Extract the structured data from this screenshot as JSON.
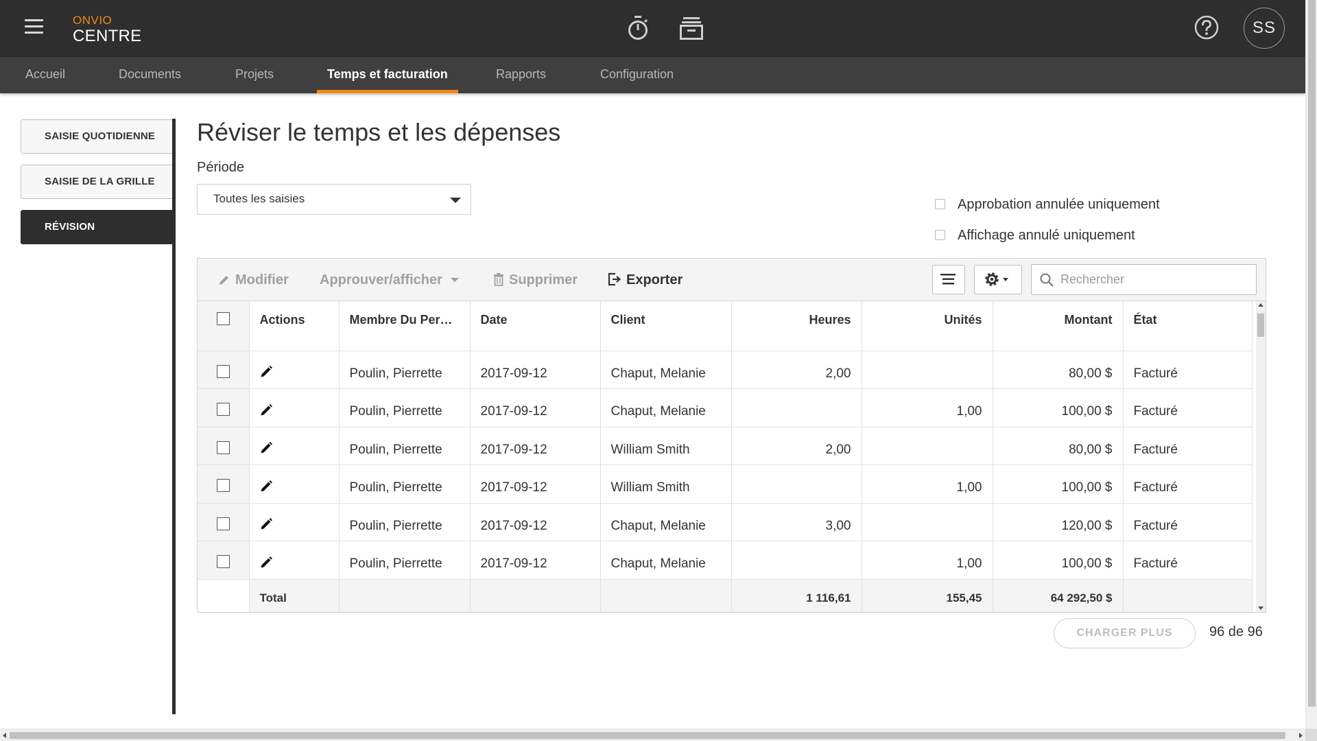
{
  "app": {
    "brand_top": "ONVIO",
    "brand_bottom": "CENTRE",
    "avatar_initials": "SS",
    "accent_color": "#f08a16",
    "header_icons": [
      "menu-icon",
      "timer-icon",
      "archive-icon",
      "help-icon"
    ]
  },
  "nav": {
    "tabs": [
      {
        "label": "Accueil"
      },
      {
        "label": "Documents"
      },
      {
        "label": "Projets"
      },
      {
        "label": "Temps et facturation",
        "active": true
      },
      {
        "label": "Rapports"
      },
      {
        "label": "Configuration"
      }
    ]
  },
  "sidebar": {
    "items": [
      {
        "label": "SAISIE QUOTIDIENNE"
      },
      {
        "label": "SAISIE DE LA GRILLE"
      },
      {
        "label": "RÉVISION",
        "active": true
      }
    ]
  },
  "main": {
    "title": "Réviser le temps et les dépenses",
    "period_label": "Période",
    "period_value": "Toutes les saisies",
    "filters": [
      {
        "label": "Approbation annulée uniquement",
        "checked": false
      },
      {
        "label": "Affichage annulé uniquement",
        "checked": false
      }
    ]
  },
  "toolbar": {
    "modify": "Modifier",
    "approve": "Approuver/afficher",
    "delete": "Supprimer",
    "export": "Exporter",
    "search_placeholder": "Rechercher"
  },
  "table": {
    "headers": {
      "actions": "Actions",
      "member": "Membre Du Pers…",
      "date": "Date",
      "client": "Client",
      "hours": "Heures",
      "units": "Unités",
      "amount": "Montant",
      "state": "État"
    },
    "rows": [
      {
        "member": "Poulin, Pierrette",
        "date": "2017-09-12",
        "client": "Chaput, Melanie",
        "hours": "2,00",
        "units": "",
        "amount": "80,00 $",
        "state": "Facturé"
      },
      {
        "member": "Poulin, Pierrette",
        "date": "2017-09-12",
        "client": "Chaput, Melanie",
        "hours": "",
        "units": "1,00",
        "amount": "100,00 $",
        "state": "Facturé"
      },
      {
        "member": "Poulin, Pierrette",
        "date": "2017-09-12",
        "client": "William Smith",
        "hours": "2,00",
        "units": "",
        "amount": "80,00 $",
        "state": "Facturé"
      },
      {
        "member": "Poulin, Pierrette",
        "date": "2017-09-12",
        "client": "William Smith",
        "hours": "",
        "units": "1,00",
        "amount": "100,00 $",
        "state": "Facturé"
      },
      {
        "member": "Poulin, Pierrette",
        "date": "2017-09-12",
        "client": "Chaput, Melanie",
        "hours": "3,00",
        "units": "",
        "amount": "120,00 $",
        "state": "Facturé"
      },
      {
        "member": "Poulin, Pierrette",
        "date": "2017-09-12",
        "client": "Chaput, Melanie",
        "hours": "",
        "units": "1,00",
        "amount": "100,00 $",
        "state": "Facturé"
      }
    ],
    "total": {
      "label": "Total",
      "hours": "1 116,61",
      "units": "155,45",
      "amount": "64 292,50 $"
    }
  },
  "footer": {
    "load_more": "CHARGER PLUS",
    "count": "96 de 96"
  }
}
